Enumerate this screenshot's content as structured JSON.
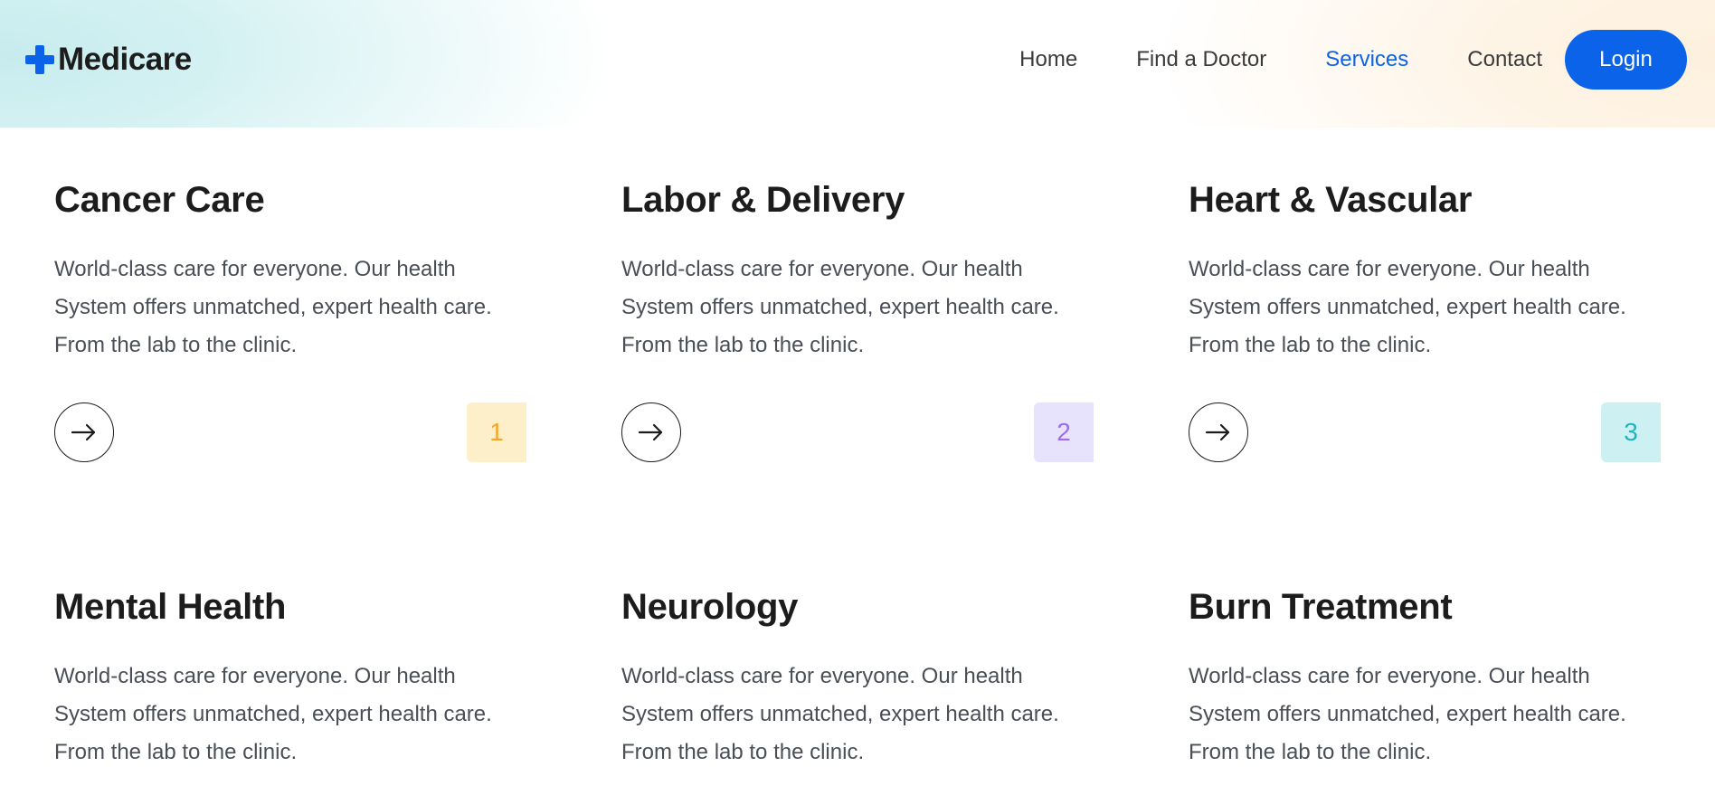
{
  "brand": {
    "name": "Medicare",
    "accent": "#0a63e8"
  },
  "nav": {
    "items": [
      {
        "label": "Home",
        "active": false
      },
      {
        "label": "Find a Doctor",
        "active": false
      },
      {
        "label": "Services",
        "active": true
      },
      {
        "label": "Contact",
        "active": false
      }
    ],
    "login_label": "Login"
  },
  "services": [
    {
      "title": "Cancer Care",
      "description": "World-class care for everyone. Our health System offers unmatched, expert health care. From the lab to the clinic.",
      "number": "1",
      "badge_bg": "#fdefc9",
      "badge_color": "#f5a623",
      "icon": "arrow-right-icon"
    },
    {
      "title": "Labor & Delivery",
      "description": "World-class care for everyone. Our health System offers unmatched, expert health care. From the lab to the clinic.",
      "number": "2",
      "badge_bg": "#e8e3fd",
      "badge_color": "#9b6cf0",
      "icon": "arrow-right-icon"
    },
    {
      "title": "Heart & Vascular",
      "description": "World-class care for everyone. Our health System offers unmatched, expert health care. From the lab to the clinic.",
      "number": "3",
      "badge_bg": "#cdf0f2",
      "badge_color": "#1fb5bd",
      "icon": "arrow-right-icon"
    },
    {
      "title": "Mental Health",
      "description": "World-class care for everyone. Our health System offers unmatched, expert health care. From the lab to the clinic."
    },
    {
      "title": "Neurology",
      "description": "World-class care for everyone. Our health System offers unmatched, expert health care. From the lab to the clinic."
    },
    {
      "title": "Burn Treatment",
      "description": "World-class care for everyone. Our health System offers unmatched, expert health care. From the lab to the clinic."
    }
  ]
}
